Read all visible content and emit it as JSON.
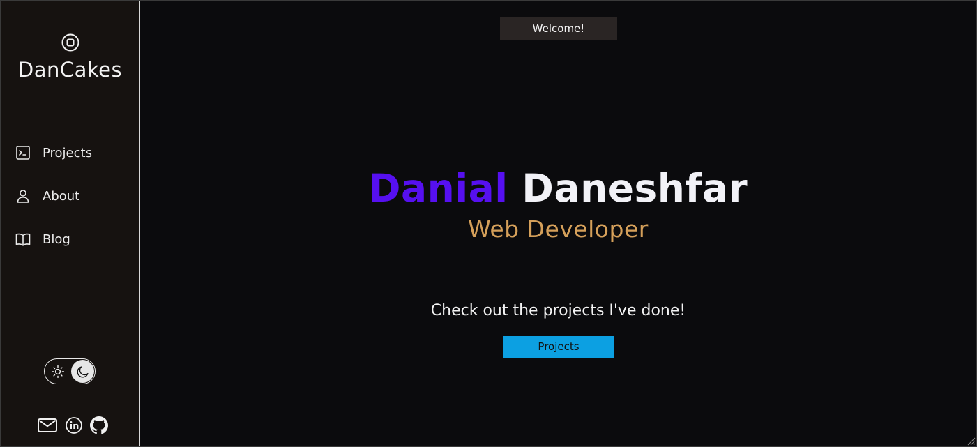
{
  "sidebar": {
    "brand": "DanCakes",
    "logo_icon": "rounded-square-in-circle-icon",
    "items": [
      {
        "label": "Projects",
        "icon": "terminal-icon"
      },
      {
        "label": "About",
        "icon": "user-icon"
      },
      {
        "label": "Blog",
        "icon": "book-open-icon"
      }
    ],
    "theme_toggle": {
      "state": "dark",
      "icons": [
        "sun-icon",
        "moon-icon"
      ]
    },
    "socials": [
      {
        "icon": "email-icon"
      },
      {
        "icon": "linkedin-icon"
      },
      {
        "icon": "github-icon"
      }
    ]
  },
  "main": {
    "welcome": "Welcome!",
    "hero": {
      "first_name": "Danial",
      "last_name": "Daneshfar",
      "role": "Web Developer"
    },
    "cta_text": "Check out the projects I've done!",
    "cta_button": "Projects"
  },
  "colors": {
    "background": "#0b0b0d",
    "sidebar_background": "#161210",
    "first_name": "#5610f0",
    "role": "#d5a05a",
    "cta_button": "#0ca0e2",
    "welcome_background": "#2a2524"
  }
}
